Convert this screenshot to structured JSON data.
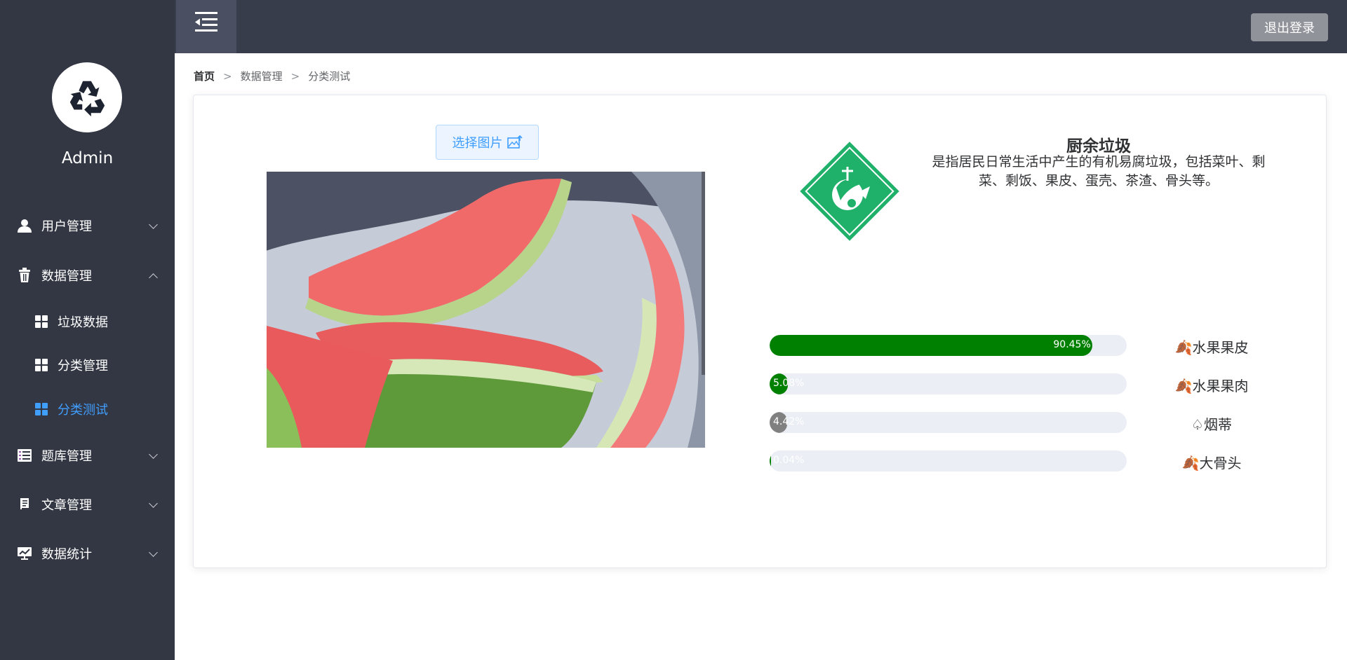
{
  "sidebar": {
    "admin_name": "Admin",
    "menu": [
      {
        "label": "用户管理",
        "icon": "user-icon",
        "expanded": false
      },
      {
        "label": "数据管理",
        "icon": "trash-icon",
        "expanded": true,
        "children": [
          {
            "label": "垃圾数据",
            "icon": "grid-icon",
            "active": false
          },
          {
            "label": "分类管理",
            "icon": "grid-icon",
            "active": false
          },
          {
            "label": "分类测试",
            "icon": "grid-icon",
            "active": true
          }
        ]
      },
      {
        "label": "题库管理",
        "icon": "list-icon",
        "expanded": false
      },
      {
        "label": "文章管理",
        "icon": "document-icon",
        "expanded": false
      },
      {
        "label": "数据统计",
        "icon": "monitor-chart-icon",
        "expanded": false
      }
    ]
  },
  "header": {
    "logout_label": "退出登录"
  },
  "breadcrumb": [
    "首页",
    "数据管理",
    "分类测试"
  ],
  "breadcrumb_separator": ">",
  "upload": {
    "choose_label": "选择图片"
  },
  "category": {
    "name": "厨余垃圾",
    "description": "是指居民日常生活中产生的有机易腐垃圾，包括菜叶、剩菜、剩饭、果皮、蛋壳、茶渣、骨头等。",
    "logo_color": "#1fb06a"
  },
  "results": [
    {
      "percent_label": "90.45%",
      "value": 90.45,
      "label": "水果果皮",
      "color": "#008000",
      "icon": "food-waste-icon"
    },
    {
      "percent_label": "5.08%",
      "value": 5.08,
      "label": "水果果肉",
      "color": "#008000",
      "icon": "food-waste-icon"
    },
    {
      "percent_label": "4.42%",
      "value": 4.42,
      "label": "烟蒂",
      "color": "#808080",
      "icon": "other-waste-icon"
    },
    {
      "percent_label": "0.04%",
      "value": 0.04,
      "label": "大骨头",
      "color": "#008000",
      "icon": "food-waste-icon"
    }
  ],
  "colors": {
    "sidebar_bg": "#333744",
    "header_bg": "#373d4a",
    "accent": "#409eff"
  }
}
